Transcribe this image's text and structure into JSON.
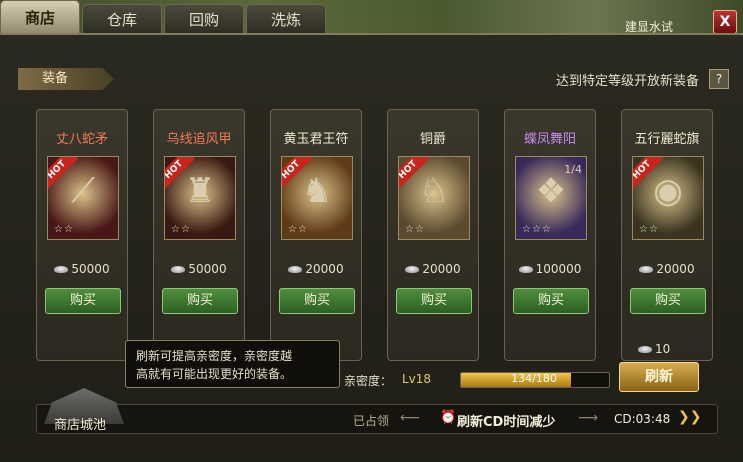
{
  "tabs": [
    "商店",
    "仓库",
    "回购",
    "洗炼"
  ],
  "top_right_text": "建显水试",
  "close_label": "X",
  "section_tag": "装备",
  "notice": "达到特定等级开放新装备",
  "help_label": "?",
  "items": [
    {
      "name": "丈八蛇矛",
      "name_color": "#f17a55",
      "price": "50000",
      "hot": "HOT",
      "stars": "☆☆",
      "buy_label": "购买",
      "icon": "spear-icon",
      "glyph": "⟋",
      "bg": "#4a1717"
    },
    {
      "name": "乌线追风甲",
      "name_color": "#f17a55",
      "price": "50000",
      "hot": "HOT",
      "stars": "☆☆",
      "buy_label": "购买",
      "icon": "armor-icon",
      "glyph": "♜",
      "bg": "#3b1812"
    },
    {
      "name": "黄玉君王符",
      "name_color": "#f1e9cf",
      "price": "20000",
      "hot": "HOT",
      "stars": "☆☆",
      "buy_label": "购买",
      "icon": "tiger-statue-icon",
      "glyph": "♞",
      "bg": "#5e3a16"
    },
    {
      "name": "铜爵",
      "name_color": "#f1e9cf",
      "price": "20000",
      "hot": "HOT",
      "stars": "☆☆",
      "buy_label": "购买",
      "icon": "horse-icon",
      "glyph": "♘",
      "bg": "#5a4a30"
    },
    {
      "name": "蝶凤舞阳",
      "name_color": "#c38bf0",
      "price": "100000",
      "hot": "",
      "stars": "☆☆☆",
      "frac": "1/4",
      "buy_label": "购买",
      "icon": "cape-icon",
      "glyph": "❖",
      "bg": "#3a2a5a"
    },
    {
      "name": "五行麗蛇旗",
      "name_color": "#f1e9cf",
      "price": "20000",
      "hot": "HOT",
      "stars": "☆☆",
      "buy_label": "购买",
      "icon": "banner-icon",
      "glyph": "◉",
      "bg": "#3a3420"
    }
  ],
  "refresh_tip": "刷新可提高亲密度，亲密度越\n高就有可能出现更好的装备。",
  "intimacy_label": "亲密度：",
  "intimacy_level": "Lv18",
  "intimacy_progress": "134/180",
  "intimacy_fraction": 0.744,
  "refresh_cost": "10",
  "refresh_label": "刷新",
  "castle_label": "商店城池",
  "occupied_label": "已占领",
  "cd_reduce_label": "刷新CD时间减少",
  "cd_timer": "CD:03:48",
  "cd_arrows": "❯❯"
}
